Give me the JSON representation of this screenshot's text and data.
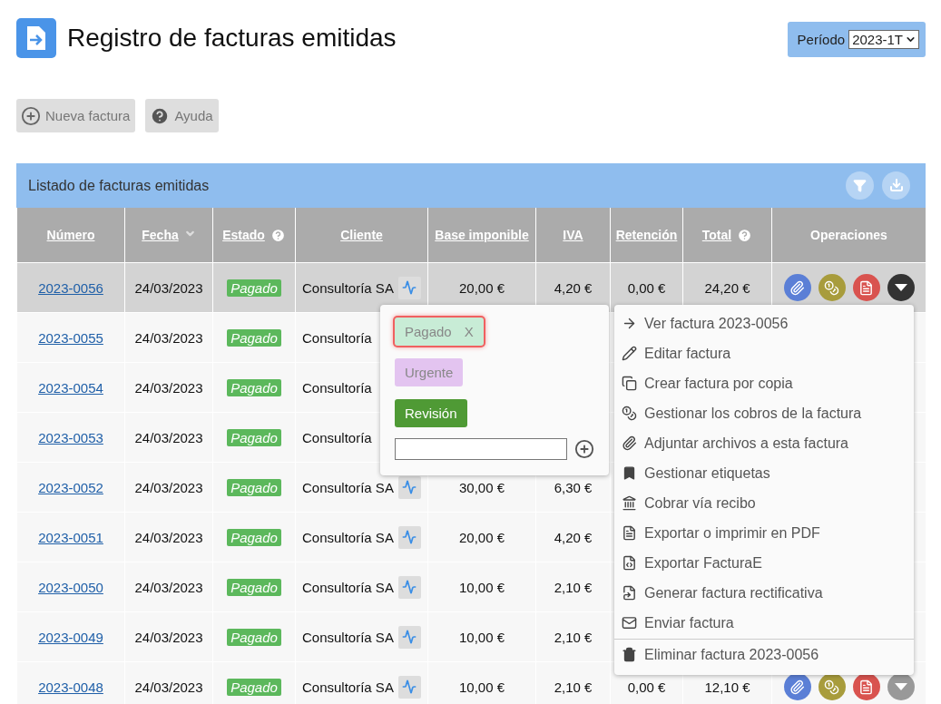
{
  "header": {
    "title": "Registro de facturas emitidas",
    "period": {
      "label": "Período",
      "value": "2023-1T"
    }
  },
  "toolbar": {
    "buttons": [
      "Nueva factura",
      "Ayuda"
    ]
  },
  "panel": {
    "title": "Listado de facturas emitidas"
  },
  "table": {
    "columns": [
      {
        "label": "Número",
        "link": true,
        "sorted": false,
        "help": false
      },
      {
        "label": "Fecha",
        "link": true,
        "sorted": true,
        "help": false
      },
      {
        "label": "Estado",
        "link": true,
        "sorted": false,
        "help": true
      },
      {
        "label": "Cliente",
        "link": true,
        "sorted": false,
        "help": false
      },
      {
        "label": "Base imponible",
        "link": true,
        "sorted": false,
        "help": false
      },
      {
        "label": "IVA",
        "link": true,
        "sorted": false,
        "help": false
      },
      {
        "label": "Retención",
        "link": true,
        "sorted": false,
        "help": false
      },
      {
        "label": "Total",
        "link": true,
        "sorted": false,
        "help": true
      },
      {
        "label": "Operaciones",
        "link": false,
        "sorted": false,
        "help": false
      }
    ],
    "rows": [
      {
        "selected": true,
        "number": "2023-0056",
        "date": "24/03/2023",
        "status": {
          "label": "Pagado",
          "color": "#5cb85c"
        },
        "client": "Consultoría SA",
        "trend": true,
        "base": "20,00 €",
        "iva": "4,20 €",
        "retention": "0,00 €",
        "total": "24,20 €",
        "actions": {
          "menu_open": true
        }
      },
      {
        "selected": false,
        "number": "2023-0055",
        "date": "24/03/2023",
        "status": {
          "label": "Pagado",
          "color": "#5cb85c"
        },
        "client": "Consultoría",
        "trend": false
      },
      {
        "selected": false,
        "number": "2023-0054",
        "date": "24/03/2023",
        "status": {
          "label": "Pagado",
          "color": "#5cb85c"
        },
        "client": "Consultoría",
        "trend": false
      },
      {
        "selected": false,
        "number": "2023-0053",
        "date": "24/03/2023",
        "status": {
          "label": "Pagado",
          "color": "#5cb85c"
        },
        "client": "Consultoría",
        "trend": false
      },
      {
        "selected": false,
        "number": "2023-0052",
        "date": "24/03/2023",
        "status": {
          "label": "Pagado",
          "color": "#5cb85c"
        },
        "client": "Consultoría SA",
        "trend": true,
        "base": "30,00 €",
        "iva": "6,30 €"
      },
      {
        "selected": false,
        "number": "2023-0051",
        "date": "24/03/2023",
        "status": {
          "label": "Pagado",
          "color": "#5cb85c"
        },
        "client": "Consultoría SA",
        "trend": true,
        "base": "20,00 €",
        "iva": "4,20 €"
      },
      {
        "selected": false,
        "number": "2023-0050",
        "date": "24/03/2023",
        "status": {
          "label": "Pagado",
          "color": "#5cb85c"
        },
        "client": "Consultoría SA",
        "trend": true,
        "base": "10,00 €",
        "iva": "2,10 €"
      },
      {
        "selected": false,
        "number": "2023-0049",
        "date": "24/03/2023",
        "status": {
          "label": "Pagado",
          "color": "#5cb85c"
        },
        "client": "Consultoría SA",
        "trend": true,
        "base": "10,00 €",
        "iva": "2,10 €"
      },
      {
        "selected": false,
        "number": "2023-0048",
        "date": "24/03/2023",
        "status": {
          "label": "Pagado",
          "color": "#5cb85c"
        },
        "client": "Consultoría SA",
        "trend": true,
        "base": "10,00 €",
        "iva": "2,10 €",
        "retention": "0,00 €",
        "total": "12,10 €",
        "actions": {
          "menu_open": false
        }
      }
    ]
  },
  "tag_popup": {
    "tags": [
      {
        "label": "Pagado",
        "remove": "X",
        "selected": true,
        "color": "#c8ecd6"
      },
      {
        "label": "Urgente",
        "selected": false,
        "color": "#e3c4f0"
      },
      {
        "label": "Revisión",
        "selected": false,
        "color": "#4f9a35"
      }
    ]
  },
  "menu": {
    "items": [
      {
        "label": "Ver factura 2023-0056",
        "kind": "action"
      },
      {
        "label": "Editar factura",
        "kind": "action"
      },
      {
        "label": "Crear factura por copia",
        "kind": "action"
      },
      {
        "label": "Gestionar los cobros de la factura",
        "kind": "action"
      },
      {
        "label": "Adjuntar archivos a esta factura",
        "kind": "action"
      },
      {
        "label": "Gestionar etiquetas",
        "kind": "action"
      },
      {
        "label": "Cobrar vía recibo",
        "kind": "action"
      },
      {
        "label": "Exportar o imprimir en PDF",
        "kind": "action"
      },
      {
        "label": "Exportar FacturaE",
        "kind": "action"
      },
      {
        "label": "Generar factura rectificativa",
        "kind": "action"
      },
      {
        "label": "Enviar factura",
        "kind": "action"
      },
      {
        "label": "Eliminar factura 2023-0056",
        "kind": "delete"
      }
    ]
  }
}
